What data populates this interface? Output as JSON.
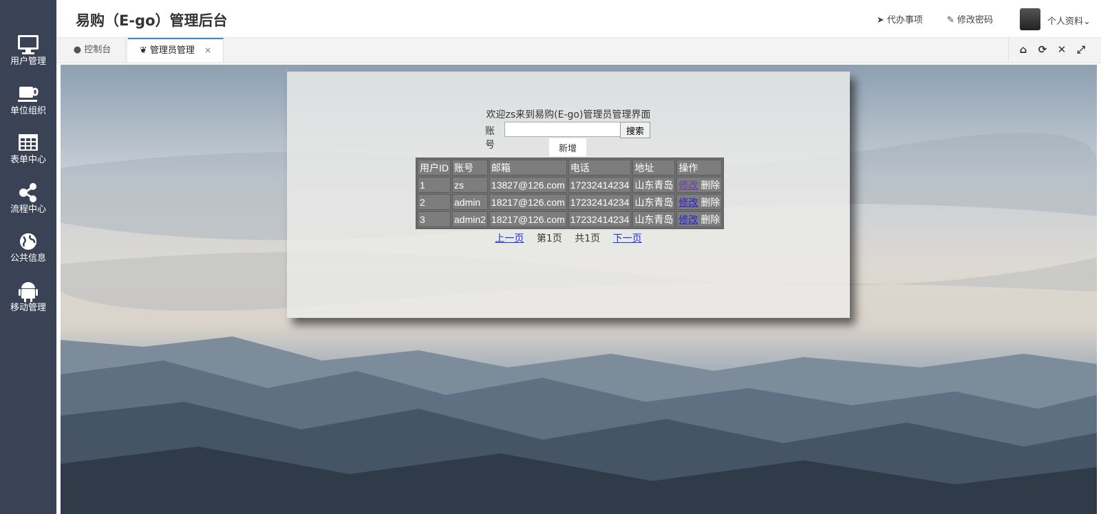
{
  "header": {
    "title": "易购（E-go）管理后台",
    "todo": "代办事项",
    "change_password": "修改密码",
    "profile": "个人资料"
  },
  "sidebar": {
    "items": [
      {
        "label": "用户管理",
        "icon": "monitor-icon"
      },
      {
        "label": "单位组织",
        "icon": "coffee-cup-icon"
      },
      {
        "label": "表单中心",
        "icon": "grid-table-icon"
      },
      {
        "label": "流程中心",
        "icon": "share-nodes-icon"
      },
      {
        "label": "公共信息",
        "icon": "globe-icon"
      },
      {
        "label": "移动管理",
        "icon": "android-icon"
      }
    ]
  },
  "tabs": [
    {
      "label": "控制台",
      "active": false
    },
    {
      "label": "管理员管理",
      "active": true,
      "close": "×"
    }
  ],
  "toolbar": {
    "icons": [
      "home-icon",
      "refresh-icon",
      "close-icon",
      "fullscreen-icon"
    ]
  },
  "panel": {
    "welcome": "欢迎zs来到易购(E-go)管理员管理界面",
    "search_label": "账号",
    "search_value": "",
    "search_button": "搜索",
    "add_button": "新增",
    "table": {
      "headers": [
        "用户ID",
        "账号",
        "邮箱",
        "电话",
        "地址",
        "操作"
      ],
      "rows": [
        {
          "id": "1",
          "account": "zs",
          "email": "13827@126.com",
          "phone": "17232414234",
          "address": "山东青岛",
          "edit": "修改",
          "delete": "删除"
        },
        {
          "id": "2",
          "account": "admin",
          "email": "18217@126.com",
          "phone": "17232414234",
          "address": "山东青岛",
          "edit": "修改",
          "delete": "删除"
        },
        {
          "id": "3",
          "account": "admin2",
          "email": "18217@126.com",
          "phone": "17232414234",
          "address": "山东青岛",
          "edit": "修改",
          "delete": "删除"
        }
      ]
    },
    "pager": {
      "prev": "上一页",
      "current": "第1页",
      "total": "共1页",
      "next": "下一页"
    }
  },
  "colors": {
    "sidebar_bg": "#3a4356",
    "active_tab_accent": "#2f8fd8",
    "link": "#1a2ee0"
  }
}
